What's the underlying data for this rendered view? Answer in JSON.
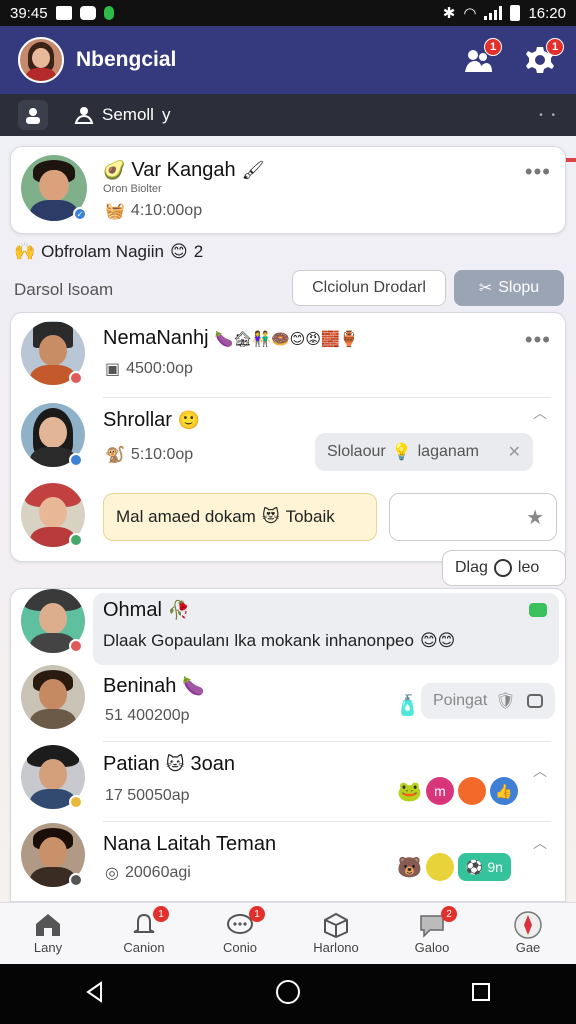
{
  "status_bar": {
    "time_left": "39:45",
    "time_right": "16:20"
  },
  "header": {
    "title": "Nbengcial",
    "notif_badge": "1",
    "settings_badge": "1"
  },
  "sub_bar": {
    "search_label": "Semoll",
    "search_suffix": "y"
  },
  "pinned": {
    "name": "Var Kangah",
    "subtitle": "Oron Biolter",
    "time": "4:10:00op",
    "lead_emoji": "🥑",
    "tail_emoji": "🖌"
  },
  "group": {
    "title": "Obfrolam Nagiin",
    "title_suffix": "2",
    "label": "Darsol lsoam",
    "btn_primary": "Clciolun Drodarl",
    "btn_secondary": "Slopu"
  },
  "chats_a": [
    {
      "name": "NemaNanhj",
      "emojis": "🍆🏚👫🍩😊😡🧱🏺",
      "time": "4500:0op"
    },
    {
      "name": "Shrollar",
      "emojis": "🙂",
      "time": "5:10:0op",
      "chip": "Slolaour",
      "chip2": "laganam"
    },
    {
      "message": "Mal amaed dokam",
      "message_tail": "Tobaik"
    }
  ],
  "float_chip": "Dlag",
  "float_chip_tail": "leo",
  "chats_b": [
    {
      "name": "Ohmal",
      "emoji": "🥀",
      "preview": "Dlaak Gopaulanı lka mokank inhanonpeo",
      "preview_emojis": "😊😊"
    },
    {
      "name": "Beninah",
      "emoji": "🍆",
      "time": "51 400200p",
      "chip": "Poingat"
    },
    {
      "name": "Patian",
      "emoji": "🐱",
      "name_tail": "3oan",
      "time": "17 50050ap"
    },
    {
      "name": "Nana Laitah Teman",
      "time": "20060agi",
      "chip": "9n"
    }
  ],
  "bottom_nav": [
    {
      "label": "Lany",
      "icon": "home-icon",
      "badge": ""
    },
    {
      "label": "Canion",
      "icon": "bell-icon",
      "badge": "1"
    },
    {
      "label": "Conio",
      "icon": "chat-icon",
      "badge": "1"
    },
    {
      "label": "Harlono",
      "icon": "cube-icon",
      "badge": ""
    },
    {
      "label": "Galoo",
      "icon": "bubble-icon",
      "badge": "2"
    },
    {
      "label": "Gae",
      "icon": "compass-icon",
      "badge": ""
    }
  ],
  "colors": {
    "header": "#353a7e",
    "accent": "#e2302d",
    "chip_yellow": "#fff5d6"
  }
}
